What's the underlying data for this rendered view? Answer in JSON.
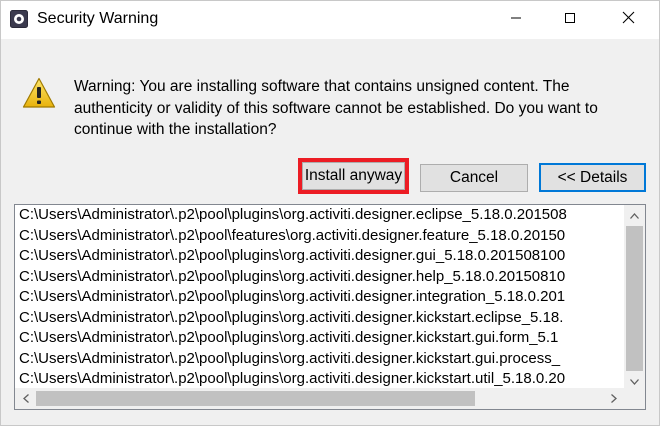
{
  "window": {
    "title": "Security Warning",
    "controls": {
      "minimize": "—",
      "maximize": "☐",
      "close": "✕"
    }
  },
  "message": "Warning: You are installing software that contains unsigned content. The authenticity or validity of this software cannot be established. Do you want to continue with the installation?",
  "buttons": {
    "install_anyway": "Install anyway",
    "cancel": "Cancel",
    "details": "<< Details"
  },
  "items": [
    "C:\\Users\\Administrator\\.p2\\pool\\plugins\\org.activiti.designer.eclipse_5.18.0.201508",
    "C:\\Users\\Administrator\\.p2\\pool\\features\\org.activiti.designer.feature_5.18.0.20150",
    "C:\\Users\\Administrator\\.p2\\pool\\plugins\\org.activiti.designer.gui_5.18.0.201508100",
    "C:\\Users\\Administrator\\.p2\\pool\\plugins\\org.activiti.designer.help_5.18.0.20150810",
    "C:\\Users\\Administrator\\.p2\\pool\\plugins\\org.activiti.designer.integration_5.18.0.201",
    "C:\\Users\\Administrator\\.p2\\pool\\plugins\\org.activiti.designer.kickstart.eclipse_5.18.",
    "C:\\Users\\Administrator\\.p2\\pool\\plugins\\org.activiti.designer.kickstart.gui.form_5.1",
    "C:\\Users\\Administrator\\.p2\\pool\\plugins\\org.activiti.designer.kickstart.gui.process_",
    "C:\\Users\\Administrator\\.p2\\pool\\plugins\\org.activiti.designer.kickstart.util_5.18.0.20"
  ],
  "colors": {
    "highlight_border": "#ec1c24",
    "focus_border": "#0078d7",
    "warning_fill": "#f2c811"
  },
  "icons": {
    "app": "eclipse-app-icon",
    "warning": "warning-triangle-icon"
  }
}
